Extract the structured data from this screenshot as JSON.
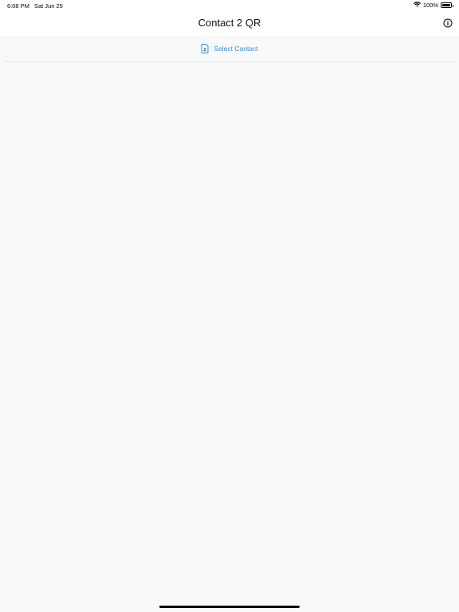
{
  "status_bar": {
    "time": "6:08 PM",
    "date": "Sat Jun 25",
    "battery": "100%",
    "battery_level": 1.0,
    "icons": [
      "wifi-icon",
      "battery-icon"
    ]
  },
  "nav_bar": {
    "title": "Contact 2 QR",
    "info_icon": "info-icon"
  },
  "actions": {
    "select_contact_label": "Select Contact",
    "select_contact_icon": "contact-document-icon"
  },
  "colors": {
    "accent": "#2b90d9",
    "background": "#f9f9f9",
    "bar_background": "#ffffff"
  }
}
